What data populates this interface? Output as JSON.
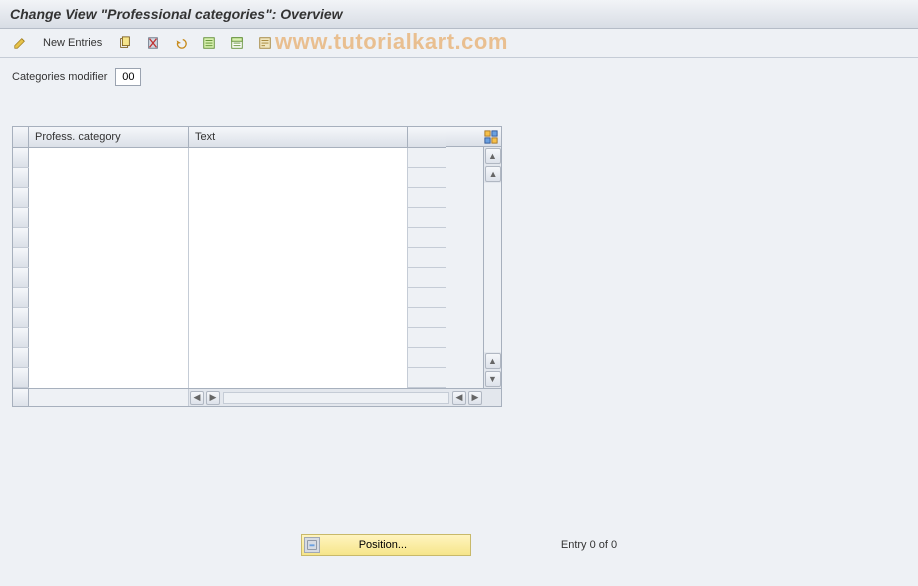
{
  "header": {
    "title": "Change View \"Professional categories\": Overview"
  },
  "toolbar": {
    "new_entries_label": "New Entries"
  },
  "watermark": "www.tutorialkart.com",
  "form": {
    "categories_modifier_label": "Categories modifier",
    "categories_modifier_value": "00"
  },
  "table": {
    "columns": {
      "category": "Profess. category",
      "text": "Text"
    },
    "row_count": 12
  },
  "footer": {
    "position_label": "Position...",
    "entry_text": "Entry 0 of 0"
  }
}
